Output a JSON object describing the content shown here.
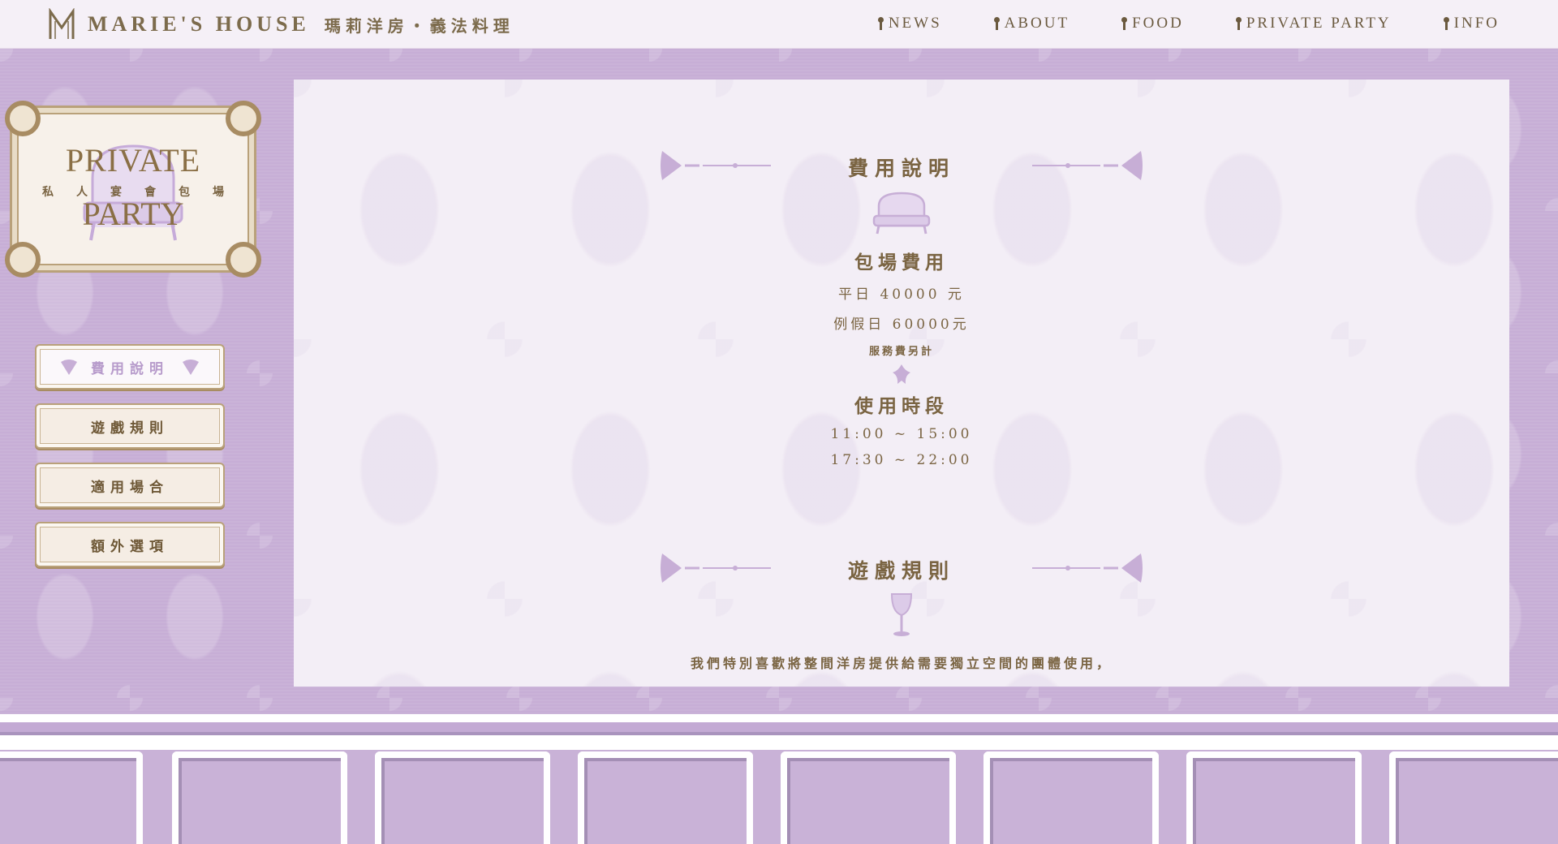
{
  "header": {
    "logo_text": "MARIE'S HOUSE",
    "logo_sub": "瑪莉洋房・義法料理",
    "nav": [
      {
        "label": "NEWS"
      },
      {
        "label": "ABOUT"
      },
      {
        "label": "FOOD"
      },
      {
        "label": "PRIVATE PARTY"
      },
      {
        "label": "INFO"
      }
    ]
  },
  "badge": {
    "top": "PRIVATE",
    "bottom": "PARTY",
    "zh": [
      "私",
      "人",
      "宴",
      "會",
      "包",
      "場"
    ]
  },
  "side_menu": [
    {
      "label": "費用說明",
      "active": true
    },
    {
      "label": "遊戲規則",
      "active": false
    },
    {
      "label": "適用場合",
      "active": false
    },
    {
      "label": "額外選項",
      "active": false
    }
  ],
  "fees": {
    "title": "費用說明",
    "subtitle": "包場費用",
    "weekday": "平日 40000 元",
    "holiday": "例假日 60000元",
    "note": "服務費另計"
  },
  "hours": {
    "subtitle": "使用時段",
    "slot1": "11:00 ~ 15:00",
    "slot2": "17:30 ~ 22:00"
  },
  "rules": {
    "title": "遊戲規則",
    "text": "我們特別喜歡將整間洋房提供給需要獨立空間的團體使用，"
  },
  "colors": {
    "accent_lavender": "#c9b2d7",
    "text_gold_brown": "#7a6442",
    "panel_bg": "#f3eef6"
  }
}
